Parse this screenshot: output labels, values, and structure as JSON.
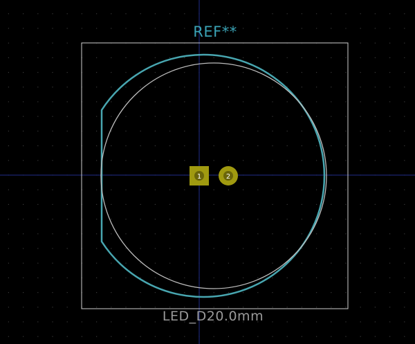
{
  "footprint": {
    "reference": "REF**",
    "value": "LED_D20.0mm"
  },
  "pads": [
    {
      "number": "1",
      "shape": "rect"
    },
    {
      "number": "2",
      "shape": "circle"
    }
  ],
  "colors": {
    "background": "#000000",
    "grid_dot": "#3a3a3a",
    "axis": "#1f2d8a",
    "silkscreen": "#48a6b0",
    "fab": "#bdbdbd",
    "courtyard": "#cfcfcf",
    "pad": "#a09a10",
    "pad_hole": "#6a650a",
    "pad_text": "#ffffff",
    "ref_text": "#3aa3b5",
    "value_text": "#9a9a9a"
  }
}
